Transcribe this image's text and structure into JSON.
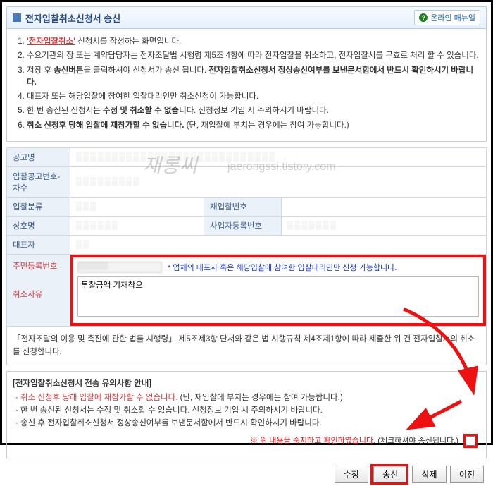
{
  "titlebar": {
    "title": "전자입찰취소신청서 송신",
    "manual": "온라인 매뉴얼"
  },
  "notes": {
    "n1a": "'전자입찰취소'",
    "n1b": " 신청서를 작성하는 화면입니다.",
    "n2": "수요기관의 장 또는 계약담당자는 전자조달법 시행령 제5조 4항에 따라 전자입찰을 취소하고, 전자입찰서를 무효로 처리 할 수 있습니다.",
    "n3a": "저장 후 ",
    "n3b": "송신버튼",
    "n3c": "을 클릭하셔야 신청서가 송신 됩니다. ",
    "n3d": "전자입찰취소신청서 정상송신여부를 보낸문서함에서 반드시 확인하시기 바랍니다.",
    "n4": "대표자 또는 해당입찰에 참여한 입찰대리인만 취소신청이 가능합니다.",
    "n5a": "한 번 송신된 신청서는 ",
    "n5b": "수정 및 취소할 수 없습니다",
    "n5c": ". 신청정보 기입 시 주의하시기 바랍니다.",
    "n6a": "취소 신청후 당해 입찰에 재참가할 수 없습니다.",
    "n6b": " (단, 재입찰에 부치는 경우에는 참여 가능합니다.)"
  },
  "form": {
    "lbl_notice": "공고명",
    "lbl_bidno": "입찰공고번호-차수",
    "lbl_bidclass": "입찰분류",
    "lbl_rebidno": "재입찰번호",
    "lbl_company": "상호명",
    "lbl_bizno": "사업자등록번호",
    "lbl_ceo": "대표자",
    "lbl_ssn": "주민등록번호",
    "lbl_reason": "취소사유",
    "blue_note": "* 업체의 대표자 혹은 해당입찰에 참여한 입찰대리인만 신청 가능합니다.",
    "reason_value": "투찰금액 기재착오"
  },
  "declaration": "「전자조달의 이용 및 촉진에 관한 법률 시행령」 제5조제3항 단서와 같은 법 시행규칙 제4조제1항에 따라 제출한 위 건 전자입찰서의 취소를 신청합니다.",
  "guide": {
    "title": "[전자입찰취소신청서 전송 유의사항 안내]",
    "g1a": "취소 신청후 당해 입찰에 재참가할 수 없습니다.",
    "g1b": " (단, 재입찰에 부치는 경우에는 참여 가능합니다.)",
    "g2": "한 번 송신된 신청서는 수정 및 취소할 수 없습니다. 신청정보 기입 시 주의하시기 바랍니다.",
    "g3": "송신 후 전자입찰취소신청서 정상송신여부를 보낸문서함에서 반드시 확인하시기 바랍니다."
  },
  "confirm": {
    "red": "※ 위 내용을 숙지하고 확인하였습니다.",
    "sub": " (체크하셔야 송신됩니다.)"
  },
  "buttons": {
    "edit": "수정",
    "send": "송신",
    "delete": "삭제",
    "back": "이전"
  },
  "watermark": {
    "a": "재롱씨",
    "b": "jaerongssi.tistory.com"
  }
}
